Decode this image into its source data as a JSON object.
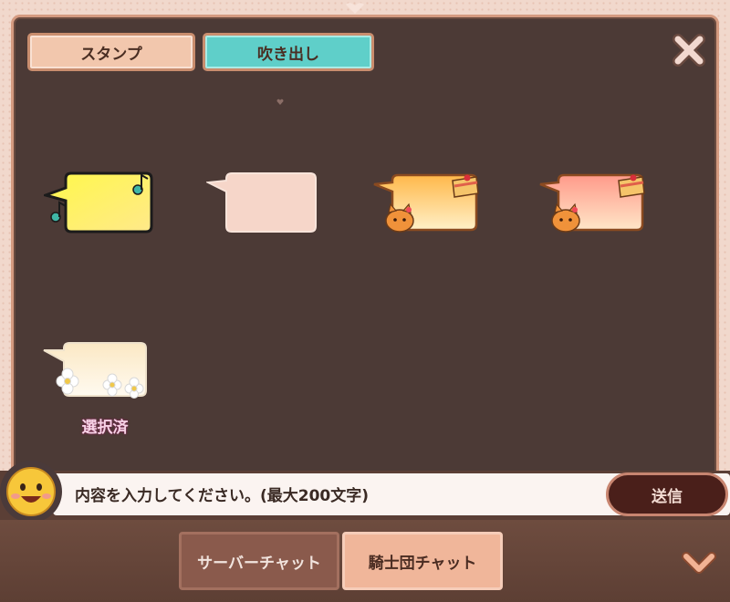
{
  "tabs": [
    {
      "label": "スタンプ",
      "active": false
    },
    {
      "label": "吹き出し",
      "active": true
    }
  ],
  "icons": {
    "close": "close-icon",
    "heart": "heart-icon",
    "face": "smiley-face-icon",
    "chevron": "chevron-down-icon"
  },
  "bubbles": [
    {
      "style": "yellow-music-notes",
      "selected": false
    },
    {
      "style": "plain-pink",
      "selected": false
    },
    {
      "style": "orange-cat-cake",
      "selected": false
    },
    {
      "style": "pink-cat-cake",
      "selected": false
    },
    {
      "style": "cream-white-flowers",
      "selected": true,
      "status_label": "選択済"
    }
  ],
  "chat_input": {
    "placeholder": "内容を入力してください。(最大200文字)",
    "send_label": "送信"
  },
  "channels": [
    {
      "label": "サーバーチャット",
      "active": false
    },
    {
      "label": "騎士団チャット",
      "active": true
    }
  ],
  "colors": {
    "panel_bg": "#4c3a36",
    "active_tab": "#5fcfc9",
    "accent_border": "#c98d6e"
  }
}
